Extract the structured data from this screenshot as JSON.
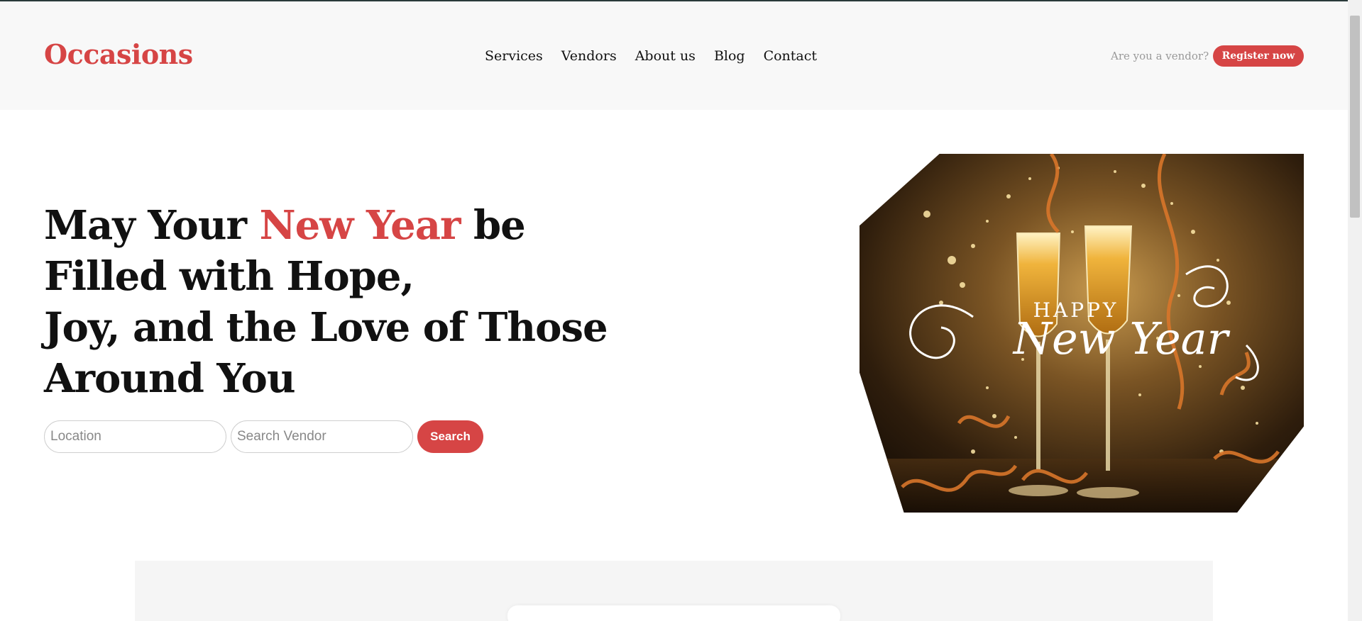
{
  "brand": {
    "logo_text": "Occasions",
    "accent_color": "#d64545"
  },
  "nav": {
    "items": [
      {
        "label": "Services"
      },
      {
        "label": "Vendors"
      },
      {
        "label": "About us"
      },
      {
        "label": "Blog"
      },
      {
        "label": "Contact"
      }
    ]
  },
  "vendor_cta": {
    "question": "Are you a vendor?",
    "button_label": "Register now"
  },
  "hero": {
    "title_part1": "May Your ",
    "title_accent": "New Year",
    "title_part2": " be",
    "title_line2": "Filled with Hope,",
    "title_line3": "Joy, and the Love of Those",
    "title_line4": "Around You",
    "image_text_top": "HAPPY",
    "image_text_main": "New Year"
  },
  "search": {
    "location_placeholder": "Location",
    "vendor_placeholder": "Search Vendor",
    "button_label": "Search"
  }
}
